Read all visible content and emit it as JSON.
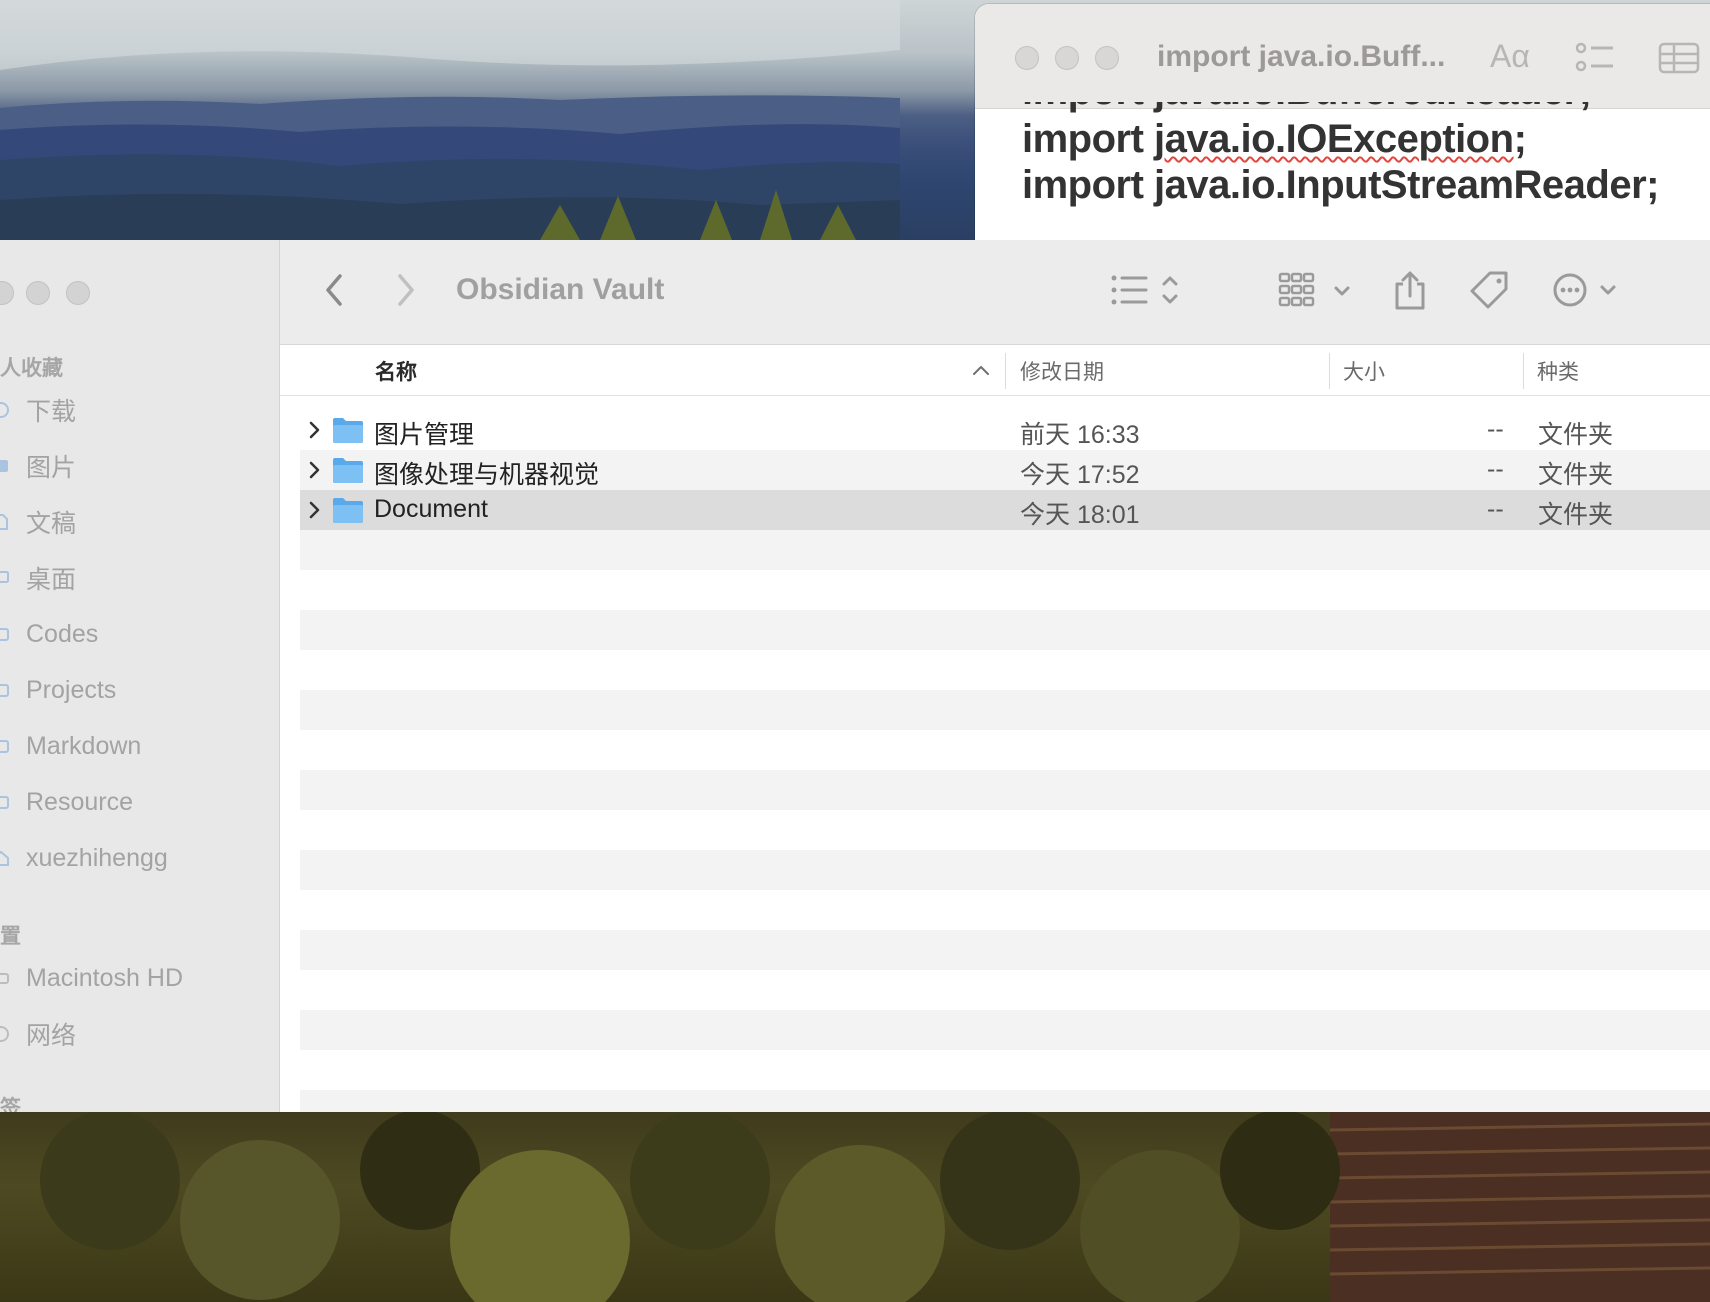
{
  "textedit": {
    "title": "import java.io.Buff...",
    "font_button": "Aα",
    "lines_partial": "import java.io.BufferedReader;",
    "line1_kw": "import ",
    "line1_pkg": "java.io.IOException",
    "line1_end": ";",
    "line2": "import java.io.InputStreamReader;",
    "icons": [
      "font-icon",
      "checklist-icon",
      "table-icon"
    ]
  },
  "finder": {
    "title": "Obsidian Vault",
    "sidebar": {
      "favorites_heading": "人收藏",
      "favorites": [
        {
          "label": "下载",
          "icon": "download-icon"
        },
        {
          "label": "图片",
          "icon": "photo-icon"
        },
        {
          "label": "文稿",
          "icon": "document-icon"
        },
        {
          "label": "桌面",
          "icon": "desktop-icon"
        },
        {
          "label": "Codes",
          "icon": "folder-icon"
        },
        {
          "label": "Projects",
          "icon": "folder-icon"
        },
        {
          "label": "Markdown",
          "icon": "folder-icon"
        },
        {
          "label": "Resource",
          "icon": "folder-icon"
        },
        {
          "label": "xuezhihengg",
          "icon": "home-icon"
        }
      ],
      "locations_heading": "置",
      "locations": [
        {
          "label": "Macintosh HD",
          "icon": "disk-icon"
        },
        {
          "label": "网络",
          "icon": "network-icon"
        }
      ],
      "tags_heading": "签"
    },
    "toolbar_icons": [
      "back-icon",
      "forward-icon",
      "list-view-icon",
      "grid-view-icon",
      "share-icon",
      "tag-icon",
      "more-icon"
    ],
    "columns": {
      "name": "名称",
      "date": "修改日期",
      "size": "大小",
      "kind": "种类"
    },
    "rows": [
      {
        "name": "图片管理",
        "date": "前天 16:33",
        "size": "--",
        "kind": "文件夹"
      },
      {
        "name": "图像处理与机器视觉",
        "date": "今天 17:52",
        "size": "--",
        "kind": "文件夹"
      },
      {
        "name": "Document",
        "date": "今天 18:01",
        "size": "--",
        "kind": "文件夹",
        "selected": true
      }
    ]
  }
}
